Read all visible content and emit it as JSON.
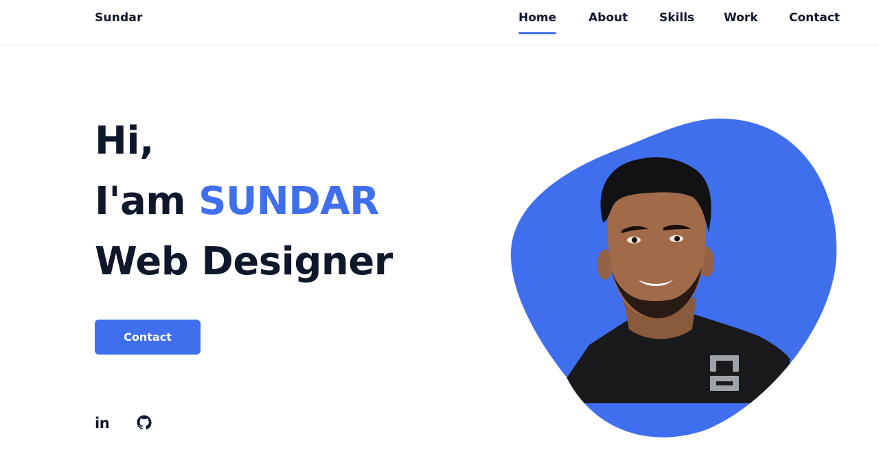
{
  "header": {
    "logo": "Sundar",
    "nav": [
      {
        "label": "Home",
        "active": true
      },
      {
        "label": "About",
        "active": false
      },
      {
        "label": "Skills",
        "active": false
      },
      {
        "label": "Work",
        "active": false
      },
      {
        "label": "Contact",
        "active": false
      }
    ]
  },
  "hero": {
    "greeting": "Hi,",
    "intro_prefix": "I'am ",
    "name": "SUNDAR",
    "role": "Web Designer",
    "cta_label": "Contact",
    "portrait_icon": "person-portrait-photo"
  },
  "socials": [
    {
      "icon": "linkedin-icon",
      "label": "in"
    },
    {
      "icon": "github-icon"
    }
  ],
  "colors": {
    "accent": "#3f6fec",
    "text": "#0f172a",
    "background": "#ffffff"
  }
}
